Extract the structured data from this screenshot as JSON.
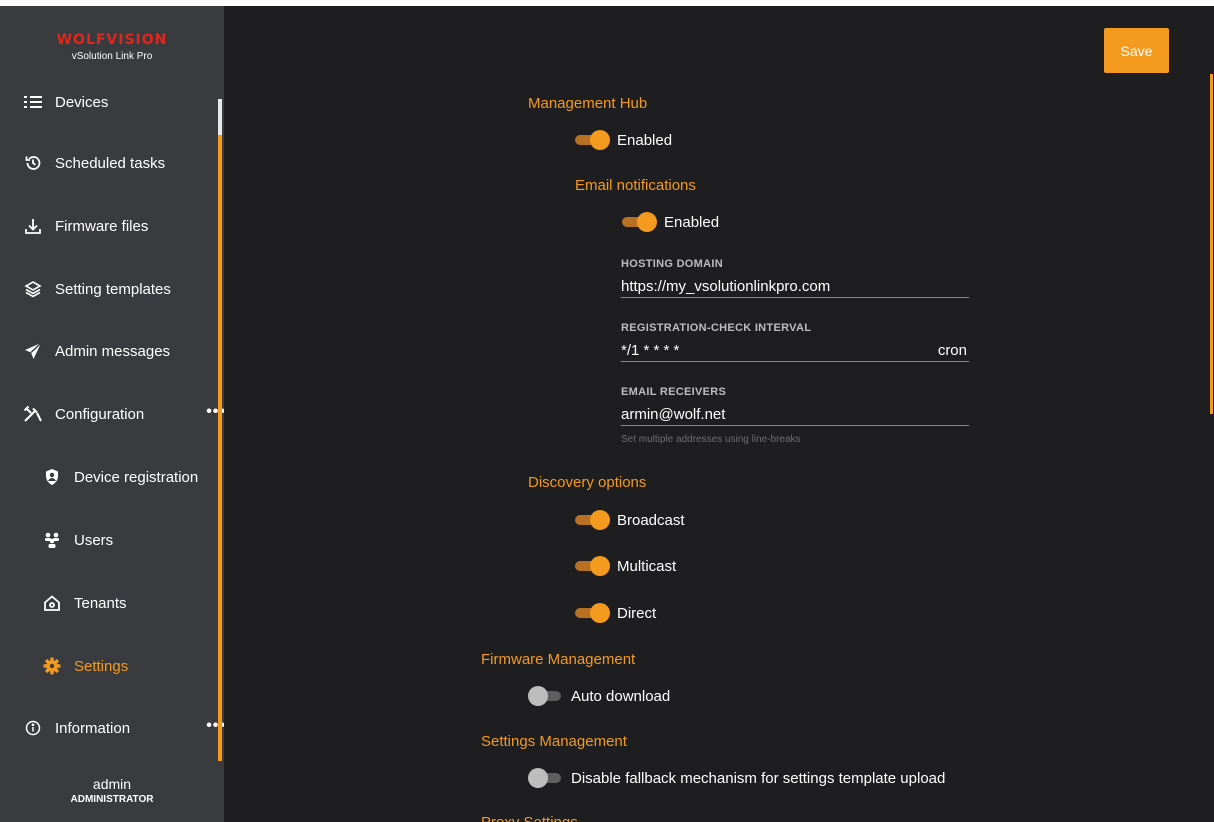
{
  "brand": {
    "logo_text": "WOLFVISION",
    "product": "vSolution Link Pro",
    "logo_color": "#e2261c",
    "accent_color": "#f39a1f"
  },
  "sidebar": {
    "items": [
      {
        "label": "Devices",
        "icon": "list-icon"
      },
      {
        "label": "Scheduled tasks",
        "icon": "history-icon"
      },
      {
        "label": "Firmware files",
        "icon": "download-icon"
      },
      {
        "label": "Setting templates",
        "icon": "layers-icon"
      },
      {
        "label": "Admin messages",
        "icon": "send-icon"
      },
      {
        "label": "Configuration",
        "icon": "tools-icon",
        "more": "•••"
      },
      {
        "label": "Device registration",
        "icon": "badge-icon"
      },
      {
        "label": "Users",
        "icon": "users-icon"
      },
      {
        "label": "Tenants",
        "icon": "home-icon"
      },
      {
        "label": "Settings",
        "icon": "gear-icon",
        "active": true
      },
      {
        "label": "Information",
        "icon": "info-icon",
        "more": "•••"
      }
    ],
    "user": {
      "name": "admin",
      "role": "ADMINISTRATOR"
    }
  },
  "toolbar": {
    "save_label": "Save"
  },
  "settings": {
    "management_hub": {
      "title": "Management Hub",
      "enabled_label": "Enabled",
      "enabled": true,
      "email_notifications": {
        "title": "Email notifications",
        "enabled_label": "Enabled",
        "enabled": true,
        "hosting_domain": {
          "label": "HOSTING DOMAIN",
          "value": "https://my_vsolutionlinkpro.com"
        },
        "registration_check_interval": {
          "label": "REGISTRATION-CHECK INTERVAL",
          "value": "*/1 * * * *",
          "suffix": "cron"
        },
        "email_receivers": {
          "label": "EMAIL RECEIVERS",
          "value": "armin@wolf.net",
          "help": "Set multiple addresses using line-breaks"
        }
      },
      "discovery_options": {
        "title": "Discovery options",
        "broadcast": {
          "label": "Broadcast",
          "enabled": true
        },
        "multicast": {
          "label": "Multicast",
          "enabled": true
        },
        "direct": {
          "label": "Direct",
          "enabled": true
        }
      }
    },
    "firmware_management": {
      "title": "Firmware Management",
      "auto_download": {
        "label": "Auto download",
        "enabled": false
      }
    },
    "settings_management": {
      "title": "Settings Management",
      "disable_fallback": {
        "label": "Disable fallback mechanism for settings template upload",
        "enabled": false
      }
    },
    "proxy_settings": {
      "title": "Proxy Settings"
    }
  }
}
